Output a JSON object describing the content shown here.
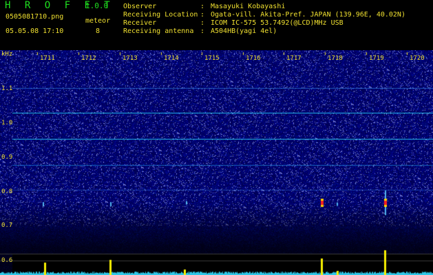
{
  "header": {
    "app_name": "H R O F F T",
    "version": "1.0.0",
    "filename": "0505081710.png",
    "meteor_label": "meteor",
    "timestamp": "05.05.08 17:10",
    "meteor_count": "8",
    "info": [
      {
        "label": "Observer",
        "value": "Masayuki Kobayashi"
      },
      {
        "label": "Receiving Location",
        "value": "Ogata-vill. Akita-Pref. JAPAN (139.96E, 40.02N)"
      },
      {
        "label": "Receiver",
        "value": "ICOM IC-575 53.7492(@LCD)MHz USB"
      },
      {
        "label": "Receiving antenna",
        "value": "A504HB(yagi 4el)"
      }
    ]
  },
  "axes": {
    "y_unit": "kHz",
    "y_ticks": [
      "1.1",
      "1.0",
      "0.9",
      "0.8",
      "0.7",
      "0.6"
    ],
    "x_ticks": [
      "1711",
      "1712",
      "1713",
      "1714",
      "1715",
      "1716",
      "1717",
      "1718",
      "1719",
      "1720"
    ]
  },
  "colors": {
    "background": "#000000",
    "text": "#f0e030",
    "title": "#1fe01f",
    "spectrogram_base": "#001c88",
    "trace": "#1ad4ff",
    "meteor_head": "#ff2020",
    "amplitude_baseline": "#2fc8e8",
    "amplitude_peak": "#f8f000"
  }
}
